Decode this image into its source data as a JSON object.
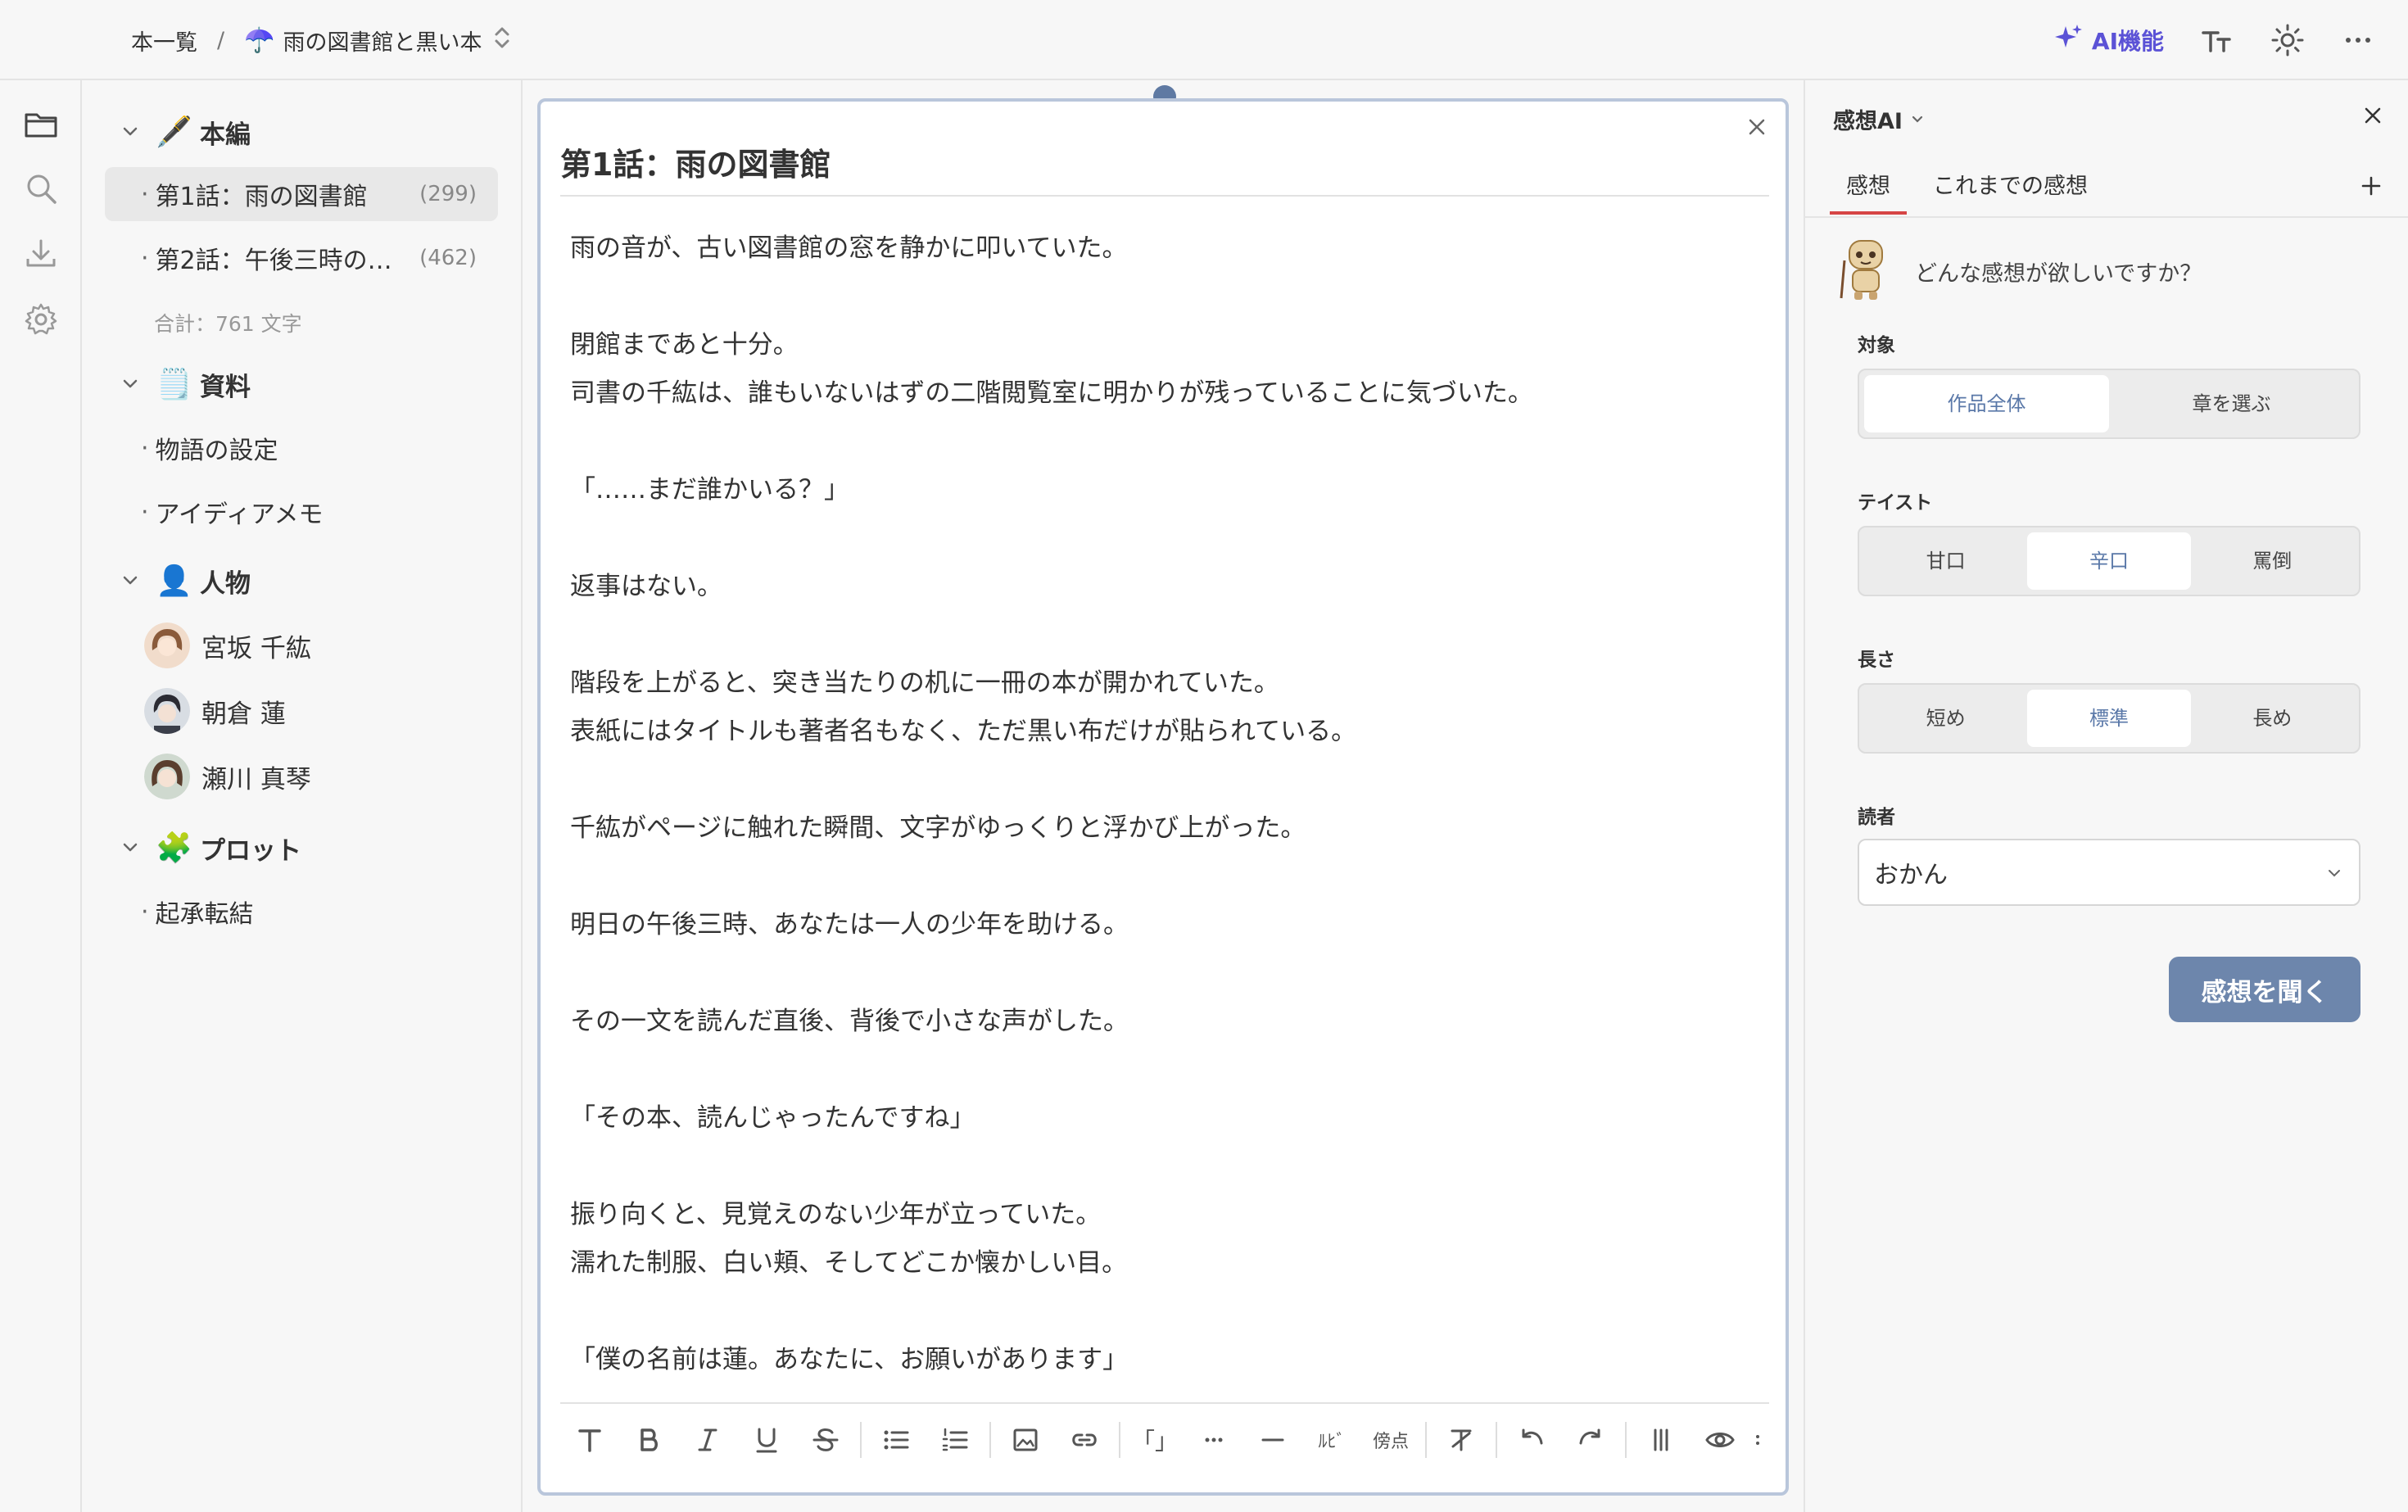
{
  "breadcrumb": {
    "root": "本一覧",
    "separator": "/",
    "book_icon": "☂️",
    "book_title": "雨の図書館と黒い本"
  },
  "topbar": {
    "ai_label": "AI機能",
    "icons": [
      "sparkle-icon",
      "font-size-icon",
      "sun-icon",
      "more-icon"
    ]
  },
  "rail": {
    "icons": [
      "folder-icon",
      "search-icon",
      "download-icon",
      "gear-icon"
    ]
  },
  "sidebar": {
    "sections": [
      {
        "emoji": "🖋️",
        "label": "本編"
      },
      {
        "emoji": "🗒️",
        "label": "資料"
      },
      {
        "emoji": "👤",
        "label": "人物"
      },
      {
        "emoji": "🧩",
        "label": "プロット"
      }
    ],
    "chapters": [
      {
        "label": "第1話：雨の図書館",
        "count": "(299)"
      },
      {
        "label": "第2話：午後三時の…",
        "count": "(462)"
      }
    ],
    "total": "合計：761 文字",
    "materials": [
      "物語の設定",
      "アイディアメモ"
    ],
    "characters": [
      "宮坂 千紘",
      "朝倉 蓮",
      "瀬川 真琴"
    ],
    "plots": [
      "起承転結"
    ]
  },
  "editor": {
    "chapter_title": "第1話：雨の図書館",
    "body": "雨の音が、古い図書館の窓を静かに叩いていた。\n\n閉館まであと十分。\n司書の千紘は、誰もいないはずの二階閲覧室に明かりが残っていることに気づいた。\n\n「……まだ誰かいる？」\n\n返事はない。\n\n階段を上がると、突き当たりの机に一冊の本が開かれていた。\n表紙にはタイトルも著者名もなく、ただ黒い布だけが貼られている。\n\n千紘がページに触れた瞬間、文字がゆっくりと浮かび上がった。\n\n明日の午後三時、あなたは一人の少年を助ける。\n\nその一文を読んだ直後、背後で小さな声がした。\n\n「その本、読んじゃったんですね」\n\n振り向くと、見覚えのない少年が立っていた。\n濡れた制服、白い頬、そしてどこか懐かしい目。\n\n「僕の名前は蓮。あなたに、お願いがあります」",
    "toolbar": {
      "bracket": "「」",
      "ruby": "ﾙﾋﾞ",
      "emphasis": "傍点"
    }
  },
  "feedback_panel": {
    "title": "感想AI",
    "tabs": [
      "感想",
      "これまでの感想"
    ],
    "prompt": "どんな感想が欲しいですか？",
    "target": {
      "label": "対象",
      "options": [
        "作品全体",
        "章を選ぶ"
      ],
      "selected": "作品全体"
    },
    "taste": {
      "label": "テイスト",
      "options": [
        "甘口",
        "辛口",
        "罵倒"
      ],
      "selected": "辛口"
    },
    "length": {
      "label": "長さ",
      "options": [
        "短め",
        "標準",
        "長め"
      ],
      "selected": "標準"
    },
    "reader": {
      "label": "読者",
      "value": "おかん"
    },
    "submit": "感想を聞く"
  }
}
